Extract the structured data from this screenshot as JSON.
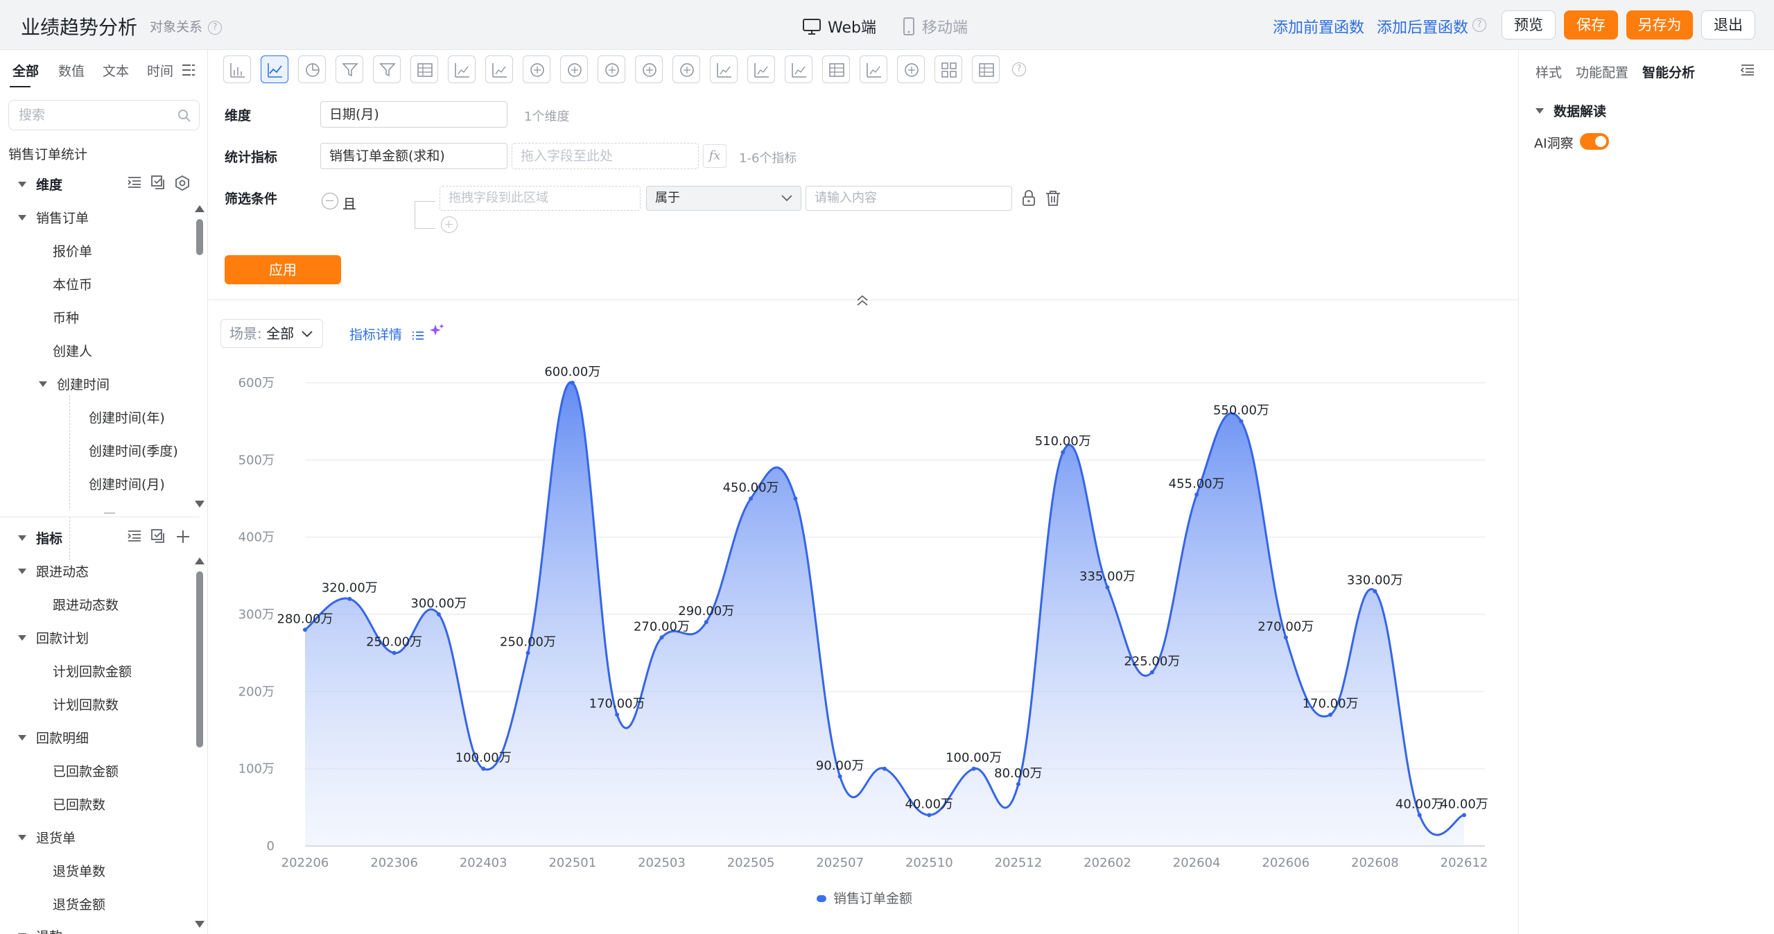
{
  "header": {
    "title": "业绩趋势分析",
    "object_link": "对象关系",
    "mode_web": "Web端",
    "mode_mobile": "移动端",
    "add_pre_fn": "添加前置函数",
    "add_post_fn": "添加后置函数",
    "preview": "预览",
    "save": "保存",
    "save_as": "另存为",
    "exit": "退出"
  },
  "left": {
    "tabs": [
      "全部",
      "数值",
      "文本",
      "时间"
    ],
    "search_placeholder": "搜索",
    "dataset": "销售订单统计",
    "dimension_title": "维度",
    "dimension_tree": {
      "group": "销售订单",
      "items": [
        "报价单",
        "本位币",
        "币种",
        "创建人"
      ],
      "time_group": "创建时间",
      "time_items": [
        "创建时间(年)",
        "创建时间(季度)",
        "创建时间(月)"
      ]
    },
    "metric_title": "指标",
    "metric_tree": [
      {
        "group": "跟进动态",
        "items": [
          "跟进动态数"
        ]
      },
      {
        "group": "回款计划",
        "items": [
          "计划回款金额",
          "计划回款数"
        ]
      },
      {
        "group": "回款明细",
        "items": [
          "已回款金额",
          "已回款数"
        ]
      },
      {
        "group": "退货单",
        "items": [
          "退货单数",
          "退货金额"
        ]
      }
    ],
    "cut_item": "退款"
  },
  "config": {
    "dimension_label": "维度",
    "dimension_value": "日期(月)",
    "dimension_hint": "1个维度",
    "metric_label": "统计指标",
    "metric_value": "销售订单金额(求和)",
    "metric_drop_placeholder": "拖入字段至此处",
    "metric_hint": "1-6个指标",
    "filter_label": "筛选条件",
    "filter_logic": "且",
    "filter_field_placeholder": "拖拽字段到此区域",
    "filter_operator": "属于",
    "filter_value_placeholder": "请输入内容",
    "apply": "应用"
  },
  "chart_header": {
    "scene_label": "场景:",
    "scene_value": "全部",
    "metric_detail": "指标详情"
  },
  "right": {
    "tabs": [
      "样式",
      "功能配置",
      "智能分析"
    ],
    "section": "数据解读",
    "ai_insight": "AI洞察",
    "ai_insight_on": true
  },
  "colors": {
    "accent": "#2b6fe0",
    "orange": "#ff7d0d",
    "series": "#3b6ff0"
  },
  "chart_data": {
    "type": "area",
    "x": [
      "202206",
      "202306",
      "202403",
      "202501",
      "202503",
      "202505",
      "202507",
      "202510",
      "202512",
      "202602",
      "202604",
      "202606",
      "202608",
      "202612"
    ],
    "tick_labels": [
      "202206",
      "202306",
      "202403",
      "202501",
      "202503",
      "202505",
      "202507",
      "202510",
      "202512",
      "202602",
      "202604",
      "202606",
      "202608",
      "202612"
    ],
    "yticks": [
      "0",
      "100万",
      "200万",
      "300万",
      "400万",
      "500万",
      "600万"
    ],
    "ylim": [
      0,
      600
    ],
    "series": [
      {
        "name": "销售订单金额",
        "values": [
          280,
          320,
          250,
          300,
          100,
          250,
          600,
          170,
          270,
          290,
          450,
          450,
          90,
          100,
          40,
          100,
          80,
          510,
          335,
          225,
          455,
          550,
          270,
          170,
          330,
          40,
          40
        ],
        "labels": [
          "280.00万",
          "320.00万",
          "250.00万",
          "300.00万",
          "100.00万",
          "250.00万",
          "600.00万",
          "170.00万",
          "270.00万",
          "290.00万",
          "450.00万",
          "",
          "90.00万",
          "",
          "40.00万",
          "100.00万",
          "80.00万",
          "510.00万",
          "335.00万",
          "225.00万",
          "455.00万",
          "550.00万",
          "270.00万",
          "170.00万",
          "330.00万",
          "40.00万",
          "40.00万"
        ]
      }
    ],
    "legend": [
      "销售订单金额"
    ],
    "legend_position": "bottom",
    "grid": true,
    "smooth": true
  }
}
